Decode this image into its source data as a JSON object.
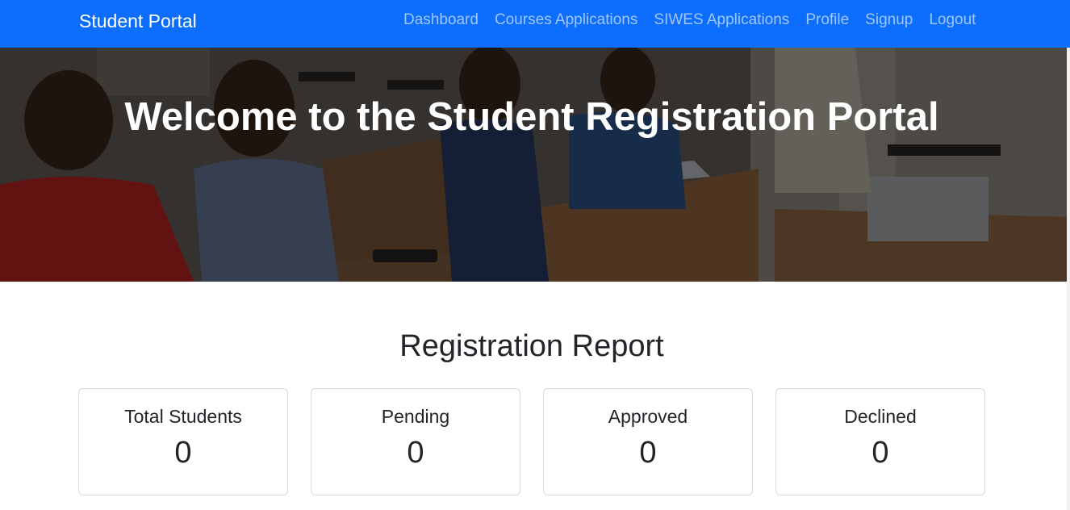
{
  "navbar": {
    "brand": "Student Portal",
    "links": [
      "Dashboard",
      "Courses Applications",
      "SIWES Applications",
      "Profile",
      "Signup",
      "Logout"
    ]
  },
  "hero": {
    "title": "Welcome to the Student Registration Portal"
  },
  "report": {
    "title": "Registration Report",
    "cards": [
      {
        "label": "Total Students",
        "value": "0"
      },
      {
        "label": "Pending",
        "value": "0"
      },
      {
        "label": "Approved",
        "value": "0"
      },
      {
        "label": "Declined",
        "value": "0"
      }
    ]
  },
  "colors": {
    "navbar": "#0d6efd",
    "nav_link": "rgba(255,255,255,0.6)",
    "card_border": "#d9dadb"
  }
}
